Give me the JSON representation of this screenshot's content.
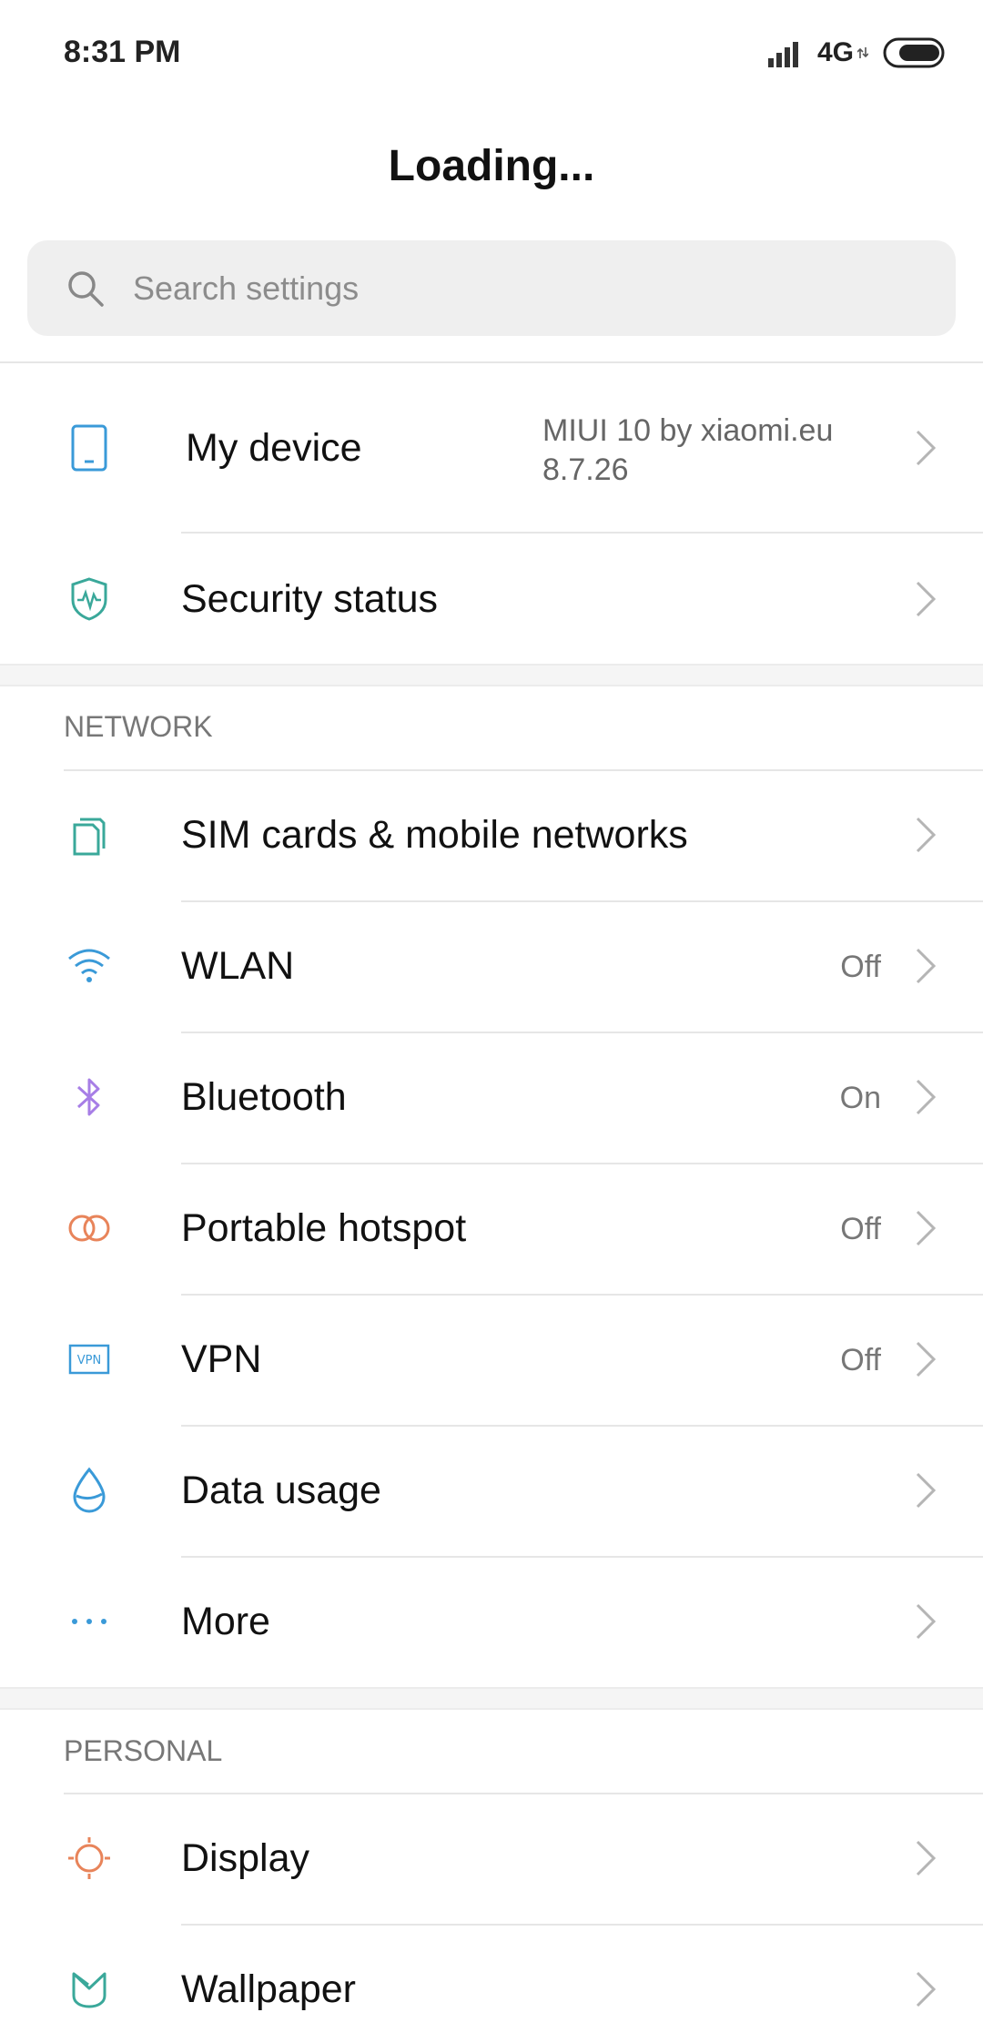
{
  "status": {
    "time": "8:31 PM",
    "network": "4G"
  },
  "header": {
    "title": "Loading..."
  },
  "search": {
    "placeholder": "Search settings"
  },
  "top_items": [
    {
      "label": "My device",
      "value_line1": "MIUI 10 by xiaomi.eu",
      "value_line2": "8.7.26",
      "icon": "phone-icon"
    },
    {
      "label": "Security status",
      "icon": "shield-icon"
    }
  ],
  "network": {
    "heading": "NETWORK",
    "items": [
      {
        "label": "SIM cards & mobile networks",
        "value": "",
        "icon": "sim-icon"
      },
      {
        "label": "WLAN",
        "value": "Off",
        "icon": "wifi-icon"
      },
      {
        "label": "Bluetooth",
        "value": "On",
        "icon": "bluetooth-icon"
      },
      {
        "label": "Portable hotspot",
        "value": "Off",
        "icon": "hotspot-icon"
      },
      {
        "label": "VPN",
        "value": "Off",
        "icon": "vpn-icon",
        "icon_text": "VPN"
      },
      {
        "label": "Data usage",
        "value": "",
        "icon": "data-drop-icon"
      },
      {
        "label": "More",
        "value": "",
        "icon": "more-dots-icon"
      }
    ]
  },
  "personal": {
    "heading": "PERSONAL",
    "items": [
      {
        "label": "Display",
        "icon": "sun-icon"
      },
      {
        "label": "Wallpaper",
        "icon": "wallpaper-icon"
      }
    ]
  },
  "colors": {
    "teal": "#3aa89a",
    "blue": "#3a9ad8",
    "purple": "#a77ee6",
    "orange": "#e8845a"
  }
}
